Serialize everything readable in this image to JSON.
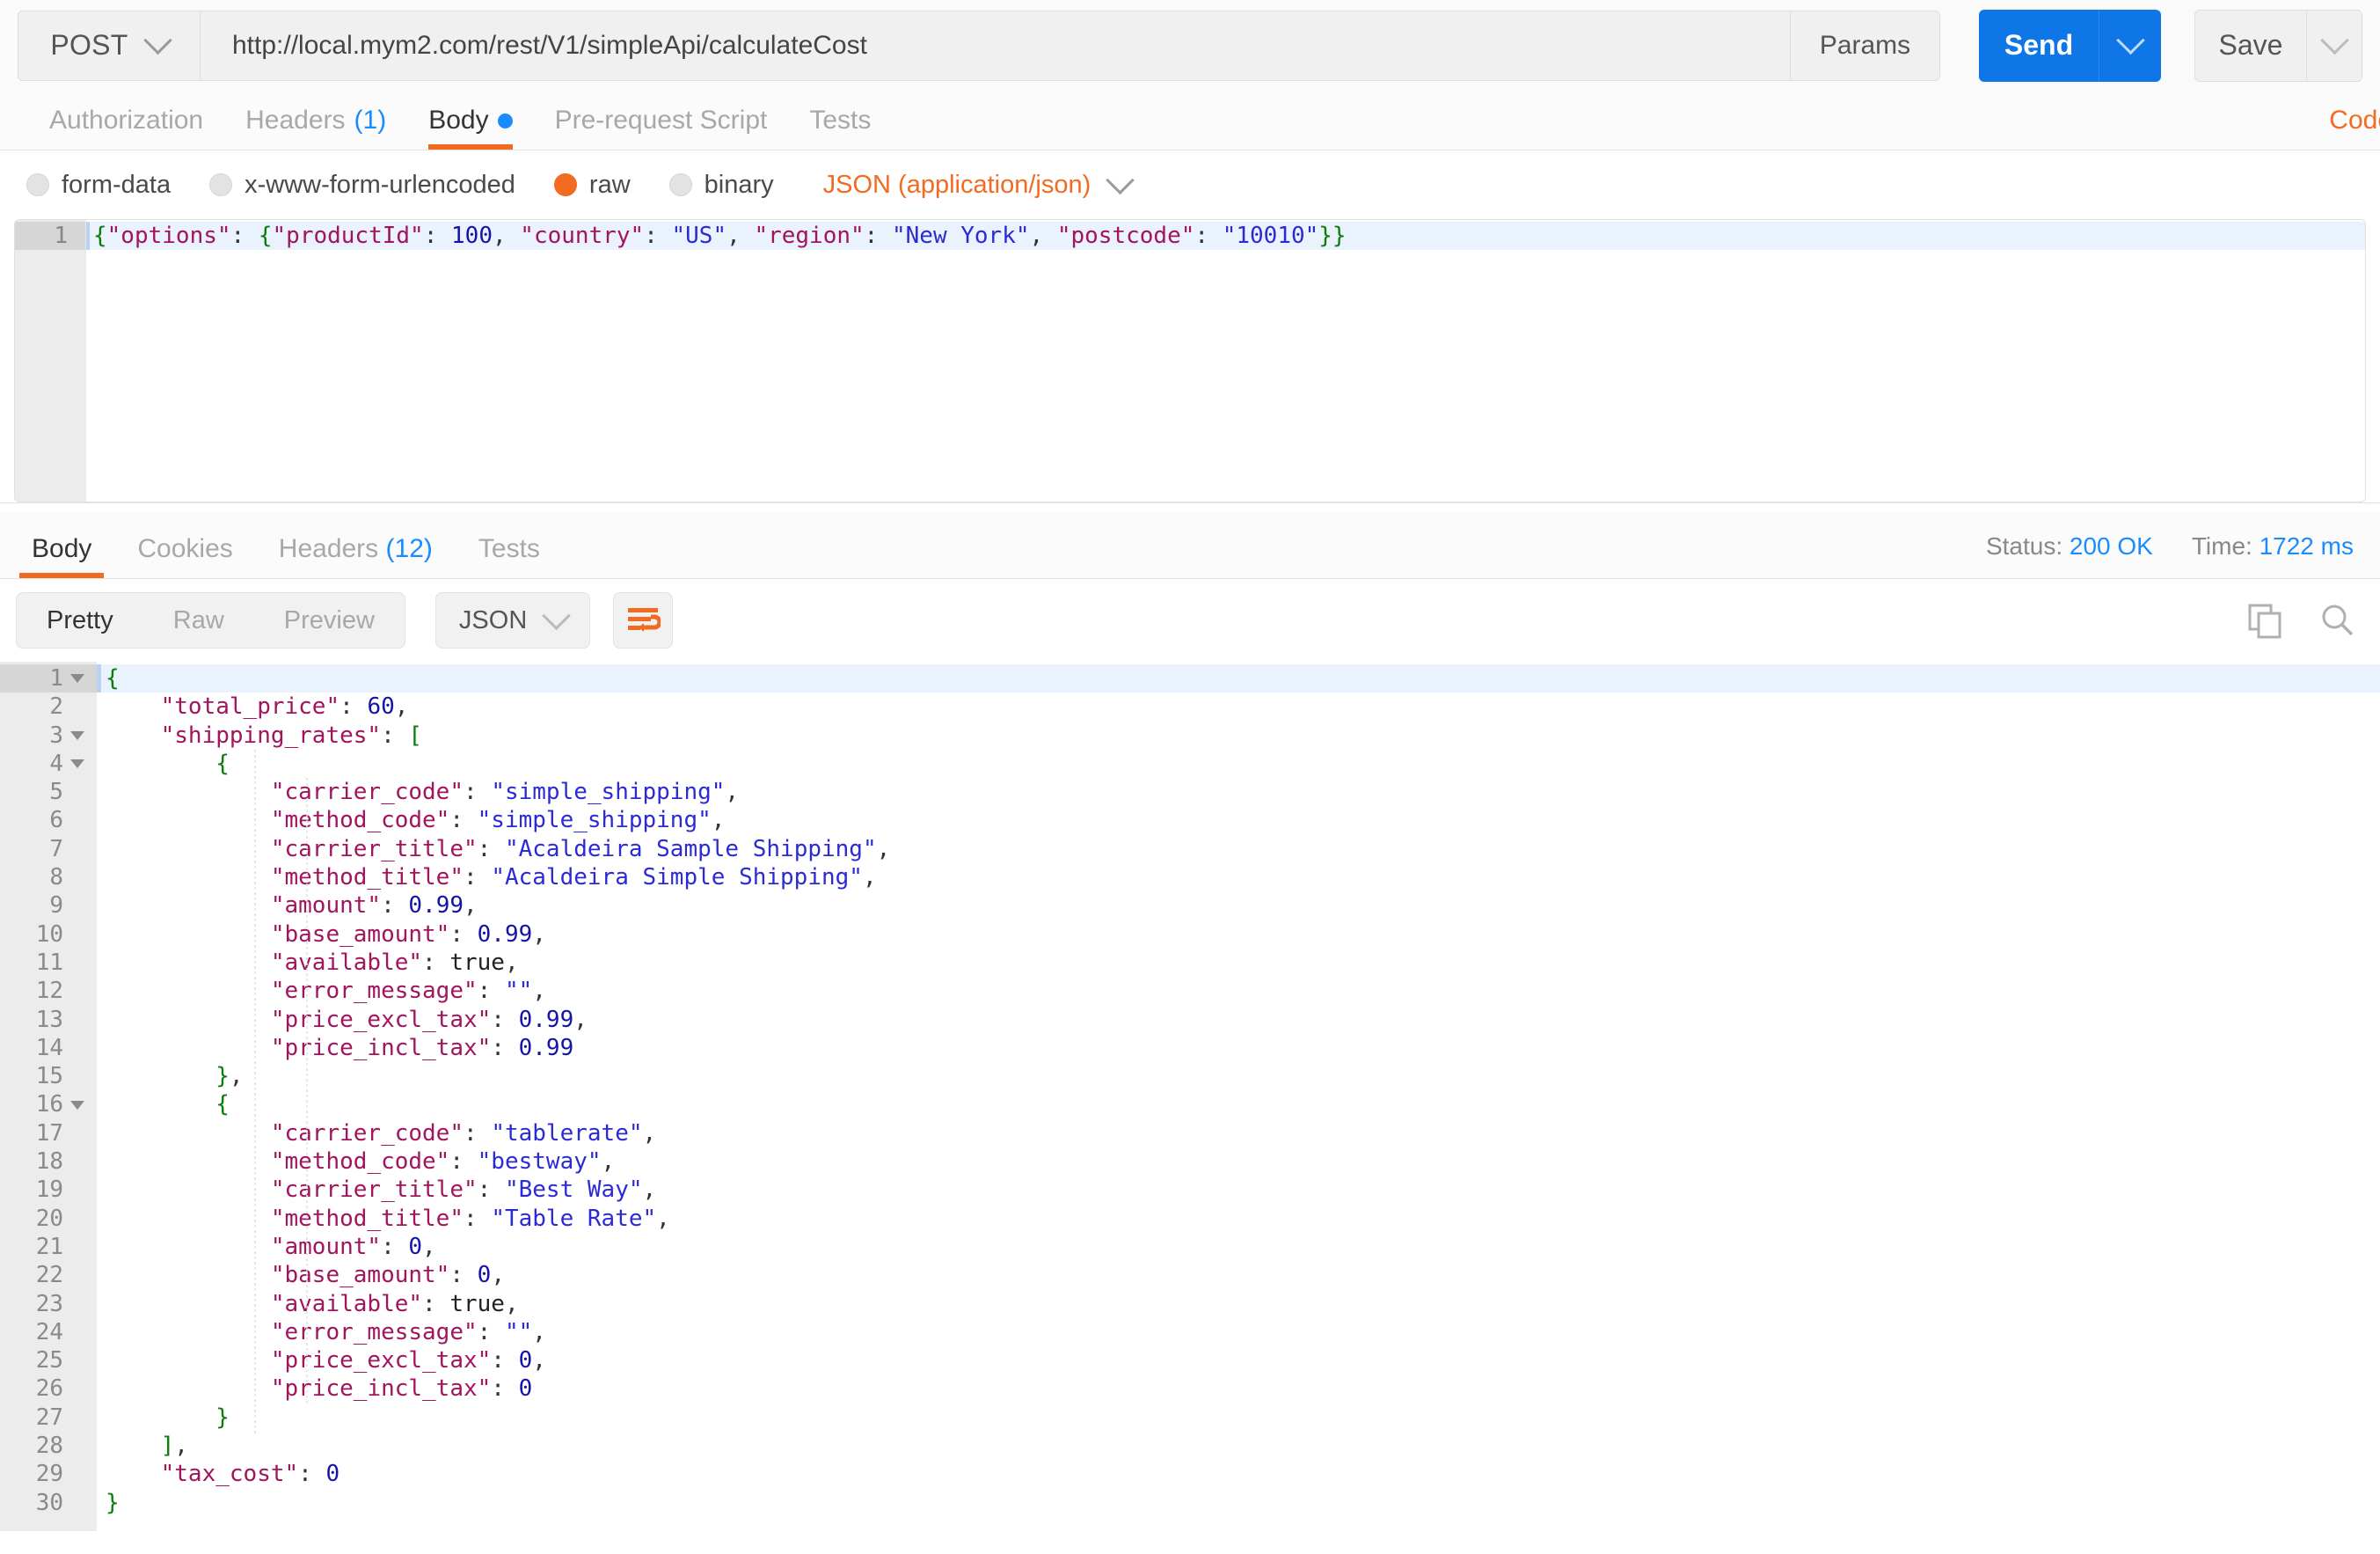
{
  "request_bar": {
    "method": "POST",
    "url": "http://local.mym2.com/rest/V1/simpleApi/calculateCost",
    "params_label": "Params",
    "send_label": "Send",
    "save_label": "Save",
    "accent_blue": "#0f76e8"
  },
  "request_tabs": {
    "items": [
      {
        "label": "Authorization",
        "count": "",
        "active": false
      },
      {
        "label": "Headers",
        "count": "(1)",
        "active": false
      },
      {
        "label": "Body",
        "count": "",
        "active": true
      },
      {
        "label": "Pre-request Script",
        "count": "",
        "active": false
      },
      {
        "label": "Tests",
        "count": "",
        "active": false
      }
    ],
    "code_link": "Code",
    "accent_orange": "#f26b21"
  },
  "body_type": {
    "options": [
      {
        "label": "form-data",
        "selected": false
      },
      {
        "label": "x-www-form-urlencoded",
        "selected": false
      },
      {
        "label": "raw",
        "selected": true
      },
      {
        "label": "binary",
        "selected": false
      }
    ],
    "content_type": "JSON (application/json)"
  },
  "request_body": {
    "lines": [
      {
        "number": "1",
        "active": true,
        "tokens": [
          {
            "t": "brace",
            "v": "{"
          },
          {
            "t": "key",
            "v": "\"options\""
          },
          {
            "t": "punct",
            "v": ": "
          },
          {
            "t": "brace",
            "v": "{"
          },
          {
            "t": "key",
            "v": "\"productId\""
          },
          {
            "t": "punct",
            "v": ": "
          },
          {
            "t": "num",
            "v": "100"
          },
          {
            "t": "punct",
            "v": ", "
          },
          {
            "t": "key",
            "v": "\"country\""
          },
          {
            "t": "punct",
            "v": ": "
          },
          {
            "t": "str",
            "v": "\"US\""
          },
          {
            "t": "punct",
            "v": ", "
          },
          {
            "t": "key",
            "v": "\"region\""
          },
          {
            "t": "punct",
            "v": ": "
          },
          {
            "t": "str",
            "v": "\"New York\""
          },
          {
            "t": "punct",
            "v": ", "
          },
          {
            "t": "key",
            "v": "\"postcode\""
          },
          {
            "t": "punct",
            "v": ": "
          },
          {
            "t": "str",
            "v": "\"10010\""
          },
          {
            "t": "brace",
            "v": "}}"
          }
        ]
      }
    ]
  },
  "response_tabs": {
    "items": [
      {
        "label": "Body",
        "count": "",
        "active": true
      },
      {
        "label": "Cookies",
        "count": "",
        "active": false
      },
      {
        "label": "Headers",
        "count": "(12)",
        "active": false
      },
      {
        "label": "Tests",
        "count": "",
        "active": false
      }
    ],
    "status_label": "Status:",
    "status_value": "200 OK",
    "time_label": "Time:",
    "time_value": "1722 ms"
  },
  "response_toolbar": {
    "view_modes": [
      {
        "label": "Pretty",
        "active": true
      },
      {
        "label": "Raw",
        "active": false
      },
      {
        "label": "Preview",
        "active": false
      }
    ],
    "format": "JSON",
    "wrap_icon": "word-wrap-icon",
    "copy_icon": "copy-icon",
    "search_icon": "search-icon"
  },
  "response_body": {
    "lines": [
      {
        "number": "1",
        "fold": true,
        "indent": 0,
        "active": true,
        "tokens": [
          {
            "t": "brace",
            "v": "{"
          }
        ]
      },
      {
        "number": "2",
        "fold": false,
        "indent": 1,
        "active": false,
        "tokens": [
          {
            "t": "key",
            "v": "\"total_price\""
          },
          {
            "t": "punct",
            "v": ": "
          },
          {
            "t": "num",
            "v": "60"
          },
          {
            "t": "punct",
            "v": ","
          }
        ]
      },
      {
        "number": "3",
        "fold": true,
        "indent": 1,
        "active": false,
        "tokens": [
          {
            "t": "key",
            "v": "\"shipping_rates\""
          },
          {
            "t": "punct",
            "v": ": "
          },
          {
            "t": "brace",
            "v": "["
          }
        ]
      },
      {
        "number": "4",
        "fold": true,
        "indent": 2,
        "active": false,
        "tokens": [
          {
            "t": "brace",
            "v": "{"
          }
        ]
      },
      {
        "number": "5",
        "fold": false,
        "indent": 3,
        "active": false,
        "tokens": [
          {
            "t": "key",
            "v": "\"carrier_code\""
          },
          {
            "t": "punct",
            "v": ": "
          },
          {
            "t": "str",
            "v": "\"simple_shipping\""
          },
          {
            "t": "punct",
            "v": ","
          }
        ]
      },
      {
        "number": "6",
        "fold": false,
        "indent": 3,
        "active": false,
        "tokens": [
          {
            "t": "key",
            "v": "\"method_code\""
          },
          {
            "t": "punct",
            "v": ": "
          },
          {
            "t": "str",
            "v": "\"simple_shipping\""
          },
          {
            "t": "punct",
            "v": ","
          }
        ]
      },
      {
        "number": "7",
        "fold": false,
        "indent": 3,
        "active": false,
        "tokens": [
          {
            "t": "key",
            "v": "\"carrier_title\""
          },
          {
            "t": "punct",
            "v": ": "
          },
          {
            "t": "str",
            "v": "\"Acaldeira Sample Shipping\""
          },
          {
            "t": "punct",
            "v": ","
          }
        ]
      },
      {
        "number": "8",
        "fold": false,
        "indent": 3,
        "active": false,
        "tokens": [
          {
            "t": "key",
            "v": "\"method_title\""
          },
          {
            "t": "punct",
            "v": ": "
          },
          {
            "t": "str",
            "v": "\"Acaldeira Simple Shipping\""
          },
          {
            "t": "punct",
            "v": ","
          }
        ]
      },
      {
        "number": "9",
        "fold": false,
        "indent": 3,
        "active": false,
        "tokens": [
          {
            "t": "key",
            "v": "\"amount\""
          },
          {
            "t": "punct",
            "v": ": "
          },
          {
            "t": "num",
            "v": "0.99"
          },
          {
            "t": "punct",
            "v": ","
          }
        ]
      },
      {
        "number": "10",
        "fold": false,
        "indent": 3,
        "active": false,
        "tokens": [
          {
            "t": "key",
            "v": "\"base_amount\""
          },
          {
            "t": "punct",
            "v": ": "
          },
          {
            "t": "num",
            "v": "0.99"
          },
          {
            "t": "punct",
            "v": ","
          }
        ]
      },
      {
        "number": "11",
        "fold": false,
        "indent": 3,
        "active": false,
        "tokens": [
          {
            "t": "key",
            "v": "\"available\""
          },
          {
            "t": "punct",
            "v": ": "
          },
          {
            "t": "bool",
            "v": "true"
          },
          {
            "t": "punct",
            "v": ","
          }
        ]
      },
      {
        "number": "12",
        "fold": false,
        "indent": 3,
        "active": false,
        "tokens": [
          {
            "t": "key",
            "v": "\"error_message\""
          },
          {
            "t": "punct",
            "v": ": "
          },
          {
            "t": "str",
            "v": "\"\""
          },
          {
            "t": "punct",
            "v": ","
          }
        ]
      },
      {
        "number": "13",
        "fold": false,
        "indent": 3,
        "active": false,
        "tokens": [
          {
            "t": "key",
            "v": "\"price_excl_tax\""
          },
          {
            "t": "punct",
            "v": ": "
          },
          {
            "t": "num",
            "v": "0.99"
          },
          {
            "t": "punct",
            "v": ","
          }
        ]
      },
      {
        "number": "14",
        "fold": false,
        "indent": 3,
        "active": false,
        "tokens": [
          {
            "t": "key",
            "v": "\"price_incl_tax\""
          },
          {
            "t": "punct",
            "v": ": "
          },
          {
            "t": "num",
            "v": "0.99"
          }
        ]
      },
      {
        "number": "15",
        "fold": false,
        "indent": 2,
        "active": false,
        "tokens": [
          {
            "t": "brace",
            "v": "}"
          },
          {
            "t": "punct",
            "v": ","
          }
        ]
      },
      {
        "number": "16",
        "fold": true,
        "indent": 2,
        "active": false,
        "tokens": [
          {
            "t": "brace",
            "v": "{"
          }
        ]
      },
      {
        "number": "17",
        "fold": false,
        "indent": 3,
        "active": false,
        "tokens": [
          {
            "t": "key",
            "v": "\"carrier_code\""
          },
          {
            "t": "punct",
            "v": ": "
          },
          {
            "t": "str",
            "v": "\"tablerate\""
          },
          {
            "t": "punct",
            "v": ","
          }
        ]
      },
      {
        "number": "18",
        "fold": false,
        "indent": 3,
        "active": false,
        "tokens": [
          {
            "t": "key",
            "v": "\"method_code\""
          },
          {
            "t": "punct",
            "v": ": "
          },
          {
            "t": "str",
            "v": "\"bestway\""
          },
          {
            "t": "punct",
            "v": ","
          }
        ]
      },
      {
        "number": "19",
        "fold": false,
        "indent": 3,
        "active": false,
        "tokens": [
          {
            "t": "key",
            "v": "\"carrier_title\""
          },
          {
            "t": "punct",
            "v": ": "
          },
          {
            "t": "str",
            "v": "\"Best Way\""
          },
          {
            "t": "punct",
            "v": ","
          }
        ]
      },
      {
        "number": "20",
        "fold": false,
        "indent": 3,
        "active": false,
        "tokens": [
          {
            "t": "key",
            "v": "\"method_title\""
          },
          {
            "t": "punct",
            "v": ": "
          },
          {
            "t": "str",
            "v": "\"Table Rate\""
          },
          {
            "t": "punct",
            "v": ","
          }
        ]
      },
      {
        "number": "21",
        "fold": false,
        "indent": 3,
        "active": false,
        "tokens": [
          {
            "t": "key",
            "v": "\"amount\""
          },
          {
            "t": "punct",
            "v": ": "
          },
          {
            "t": "num",
            "v": "0"
          },
          {
            "t": "punct",
            "v": ","
          }
        ]
      },
      {
        "number": "22",
        "fold": false,
        "indent": 3,
        "active": false,
        "tokens": [
          {
            "t": "key",
            "v": "\"base_amount\""
          },
          {
            "t": "punct",
            "v": ": "
          },
          {
            "t": "num",
            "v": "0"
          },
          {
            "t": "punct",
            "v": ","
          }
        ]
      },
      {
        "number": "23",
        "fold": false,
        "indent": 3,
        "active": false,
        "tokens": [
          {
            "t": "key",
            "v": "\"available\""
          },
          {
            "t": "punct",
            "v": ": "
          },
          {
            "t": "bool",
            "v": "true"
          },
          {
            "t": "punct",
            "v": ","
          }
        ]
      },
      {
        "number": "24",
        "fold": false,
        "indent": 3,
        "active": false,
        "tokens": [
          {
            "t": "key",
            "v": "\"error_message\""
          },
          {
            "t": "punct",
            "v": ": "
          },
          {
            "t": "str",
            "v": "\"\""
          },
          {
            "t": "punct",
            "v": ","
          }
        ]
      },
      {
        "number": "25",
        "fold": false,
        "indent": 3,
        "active": false,
        "tokens": [
          {
            "t": "key",
            "v": "\"price_excl_tax\""
          },
          {
            "t": "punct",
            "v": ": "
          },
          {
            "t": "num",
            "v": "0"
          },
          {
            "t": "punct",
            "v": ","
          }
        ]
      },
      {
        "number": "26",
        "fold": false,
        "indent": 3,
        "active": false,
        "tokens": [
          {
            "t": "key",
            "v": "\"price_incl_tax\""
          },
          {
            "t": "punct",
            "v": ": "
          },
          {
            "t": "num",
            "v": "0"
          }
        ]
      },
      {
        "number": "27",
        "fold": false,
        "indent": 2,
        "active": false,
        "tokens": [
          {
            "t": "brace",
            "v": "}"
          }
        ]
      },
      {
        "number": "28",
        "fold": false,
        "indent": 1,
        "active": false,
        "tokens": [
          {
            "t": "brace",
            "v": "]"
          },
          {
            "t": "punct",
            "v": ","
          }
        ]
      },
      {
        "number": "29",
        "fold": false,
        "indent": 1,
        "active": false,
        "tokens": [
          {
            "t": "key",
            "v": "\"tax_cost\""
          },
          {
            "t": "punct",
            "v": ": "
          },
          {
            "t": "num",
            "v": "0"
          }
        ]
      },
      {
        "number": "30",
        "fold": false,
        "indent": 0,
        "active": false,
        "tokens": [
          {
            "t": "brace",
            "v": "}"
          }
        ]
      }
    ]
  }
}
